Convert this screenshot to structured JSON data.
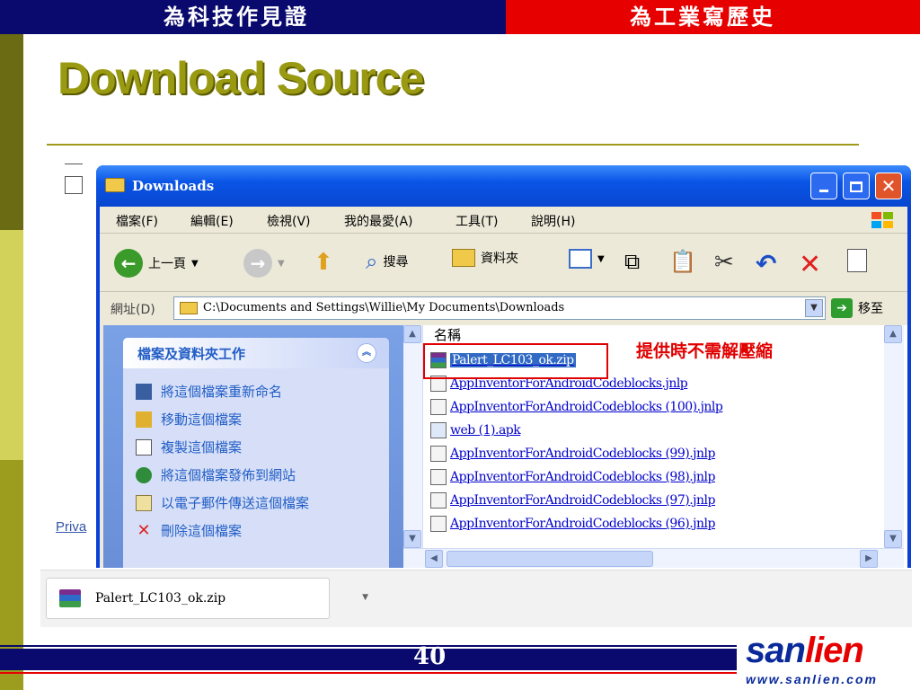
{
  "slide": {
    "banner_left": "為科技作見證",
    "banner_right": "為工業寫歷史",
    "title": "Download Source",
    "page_number": "40",
    "note": "提供時不需解壓縮",
    "bg_link": "Priva",
    "logo_text_a": "san",
    "logo_text_b": "lien",
    "logo_url": "www.sanlien.com"
  },
  "window": {
    "title": "Downloads",
    "menu": [
      "檔案(F)",
      "編輯(E)",
      "檢視(V)",
      "我的最愛(A)",
      "工具(T)",
      "說明(H)"
    ],
    "toolbar": {
      "back": "上一頁",
      "search": "搜尋",
      "folders": "資料夾"
    },
    "address": {
      "label": "網址(D)",
      "path": "C:\\Documents and Settings\\Willie\\My Documents\\Downloads",
      "go": "移至"
    },
    "task_pane": {
      "header": "檔案及資料夾工作",
      "items": [
        "將這個檔案重新命名",
        "移動這個檔案",
        "複製這個檔案",
        "將這個檔案發佈到網站",
        "以電子郵件傳送這個檔案",
        "刪除這個檔案"
      ]
    },
    "file_list": {
      "column": "名稱",
      "files": [
        "Palert_LC103_ok.zip",
        "AppInventorForAndroidCodeblocks.jnlp",
        "AppInventorForAndroidCodeblocks (100).jnlp",
        "web (1).apk",
        "AppInventorForAndroidCodeblocks (99).jnlp",
        "AppInventorForAndroidCodeblocks (98).jnlp",
        "AppInventorForAndroidCodeblocks (97).jnlp",
        "AppInventorForAndroidCodeblocks (96).jnlp"
      ]
    }
  },
  "download_bar": {
    "file": "Palert_LC103_ok.zip"
  },
  "colors": {
    "banner_blue": "#0a0a6e",
    "banner_red": "#e60000",
    "title_olive": "#9a9a12",
    "xp_blue": "#0a55e6",
    "link_blue": "#0000cc",
    "note_red": "#e00000"
  }
}
